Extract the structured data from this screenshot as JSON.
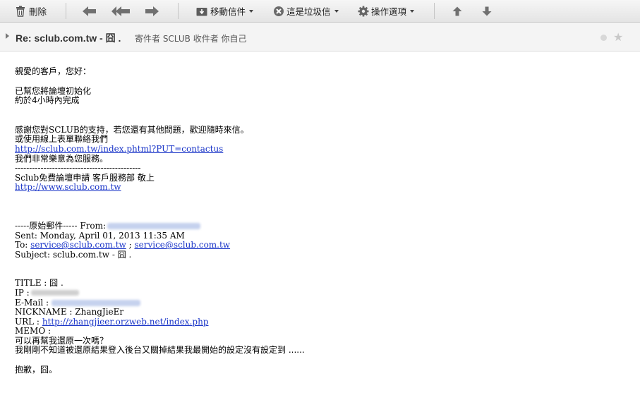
{
  "toolbar": {
    "delete_label": "刪除",
    "move_label": "移動信件",
    "spam_label": "這是垃圾信",
    "actions_label": "操作選項"
  },
  "header": {
    "subject": "Re: sclub.com.tw - 囧 .",
    "meta": "寄件者 SCLUB 收件者 你自己"
  },
  "body": {
    "greeting": "親愛的客戶，您好：",
    "l1": "已幫您將論壇初始化",
    "l2": "約於4小時內完成",
    "l3": "感謝您對SCLUB的支持，若您還有其他問題，歡迎隨時來信。",
    "l4": "或使用線上表單聯絡我們",
    "contact_link": "http://sclub.com.tw/index.phtml?PUT=contactus",
    "l5": "我們非常樂意為您服務。",
    "divider": "--------------------------------------------",
    "signature": "Sclub免費論壇申請 客戶服務部 敬上",
    "site_link": "http://www.sclub.com.tw",
    "orig_label": "-----原始郵件----- From:",
    "sent": "Sent: Monday, April 01, 2013 11:35 AM",
    "to_label": "To:",
    "to1": "service@sclub.com.tw",
    "to_sep": " ;",
    "to2": "service@sclub.com.tw",
    "subject_line": "Subject: sclub.com.tw - 囧 .",
    "title_line": "TITLE : 囧 .",
    "ip_label": "IP :",
    "email_label": "E-Mail :",
    "nickname": "NICKNAME : ZhangJieEr",
    "url_label": "URL :",
    "url_link": "http://zhangjieer.orzweb.net/index.php",
    "memo": "MEMO :",
    "m1": "可以再幫我還原一次嗎？",
    "m2": "我剛剛不知道被還原結果登入後台又關掉結果我最開始的設定沒有設定到 ......",
    "closing": "抱歉，囧。"
  }
}
